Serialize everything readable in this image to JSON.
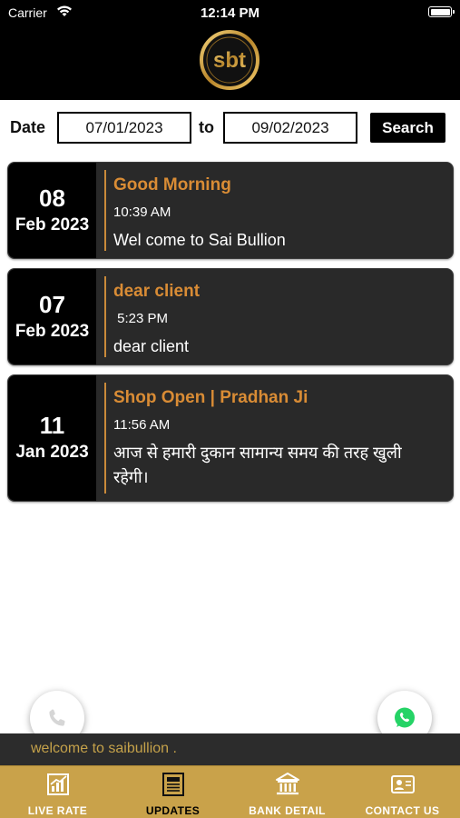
{
  "status_bar": {
    "carrier": "Carrier",
    "time": "12:14 PM"
  },
  "header": {
    "logo_text": "sbt"
  },
  "filter": {
    "date_label": "Date",
    "from_value": "07/01/2023",
    "to_label": "to",
    "to_value": "09/02/2023",
    "search_label": "Search"
  },
  "updates": [
    {
      "day": "08",
      "month": "Feb 2023",
      "title": "Good Morning",
      "time": "10:39 AM",
      "message": "Wel come to Sai Bullion"
    },
    {
      "day": "07",
      "month": "Feb 2023",
      "title": "dear client",
      "time": " 5:23 PM",
      "message": "dear client"
    },
    {
      "day": "11",
      "month": "Jan 2023",
      "title": "Shop Open | Pradhan Ji",
      "time": "11:56 AM",
      "message": "आज से हमारी दुकान सामान्य समय की तरह खुली रहेगी।"
    }
  ],
  "ticker": {
    "text": "welcome to saibullion ."
  },
  "tabs": [
    {
      "label": "LIVE RATE",
      "icon": "chart-icon",
      "active": false
    },
    {
      "label": "UPDATES",
      "icon": "newspaper-icon",
      "active": true
    },
    {
      "label": "BANK DETAIL",
      "icon": "bank-icon",
      "active": false
    },
    {
      "label": "CONTACT US",
      "icon": "contact-card-icon",
      "active": false
    }
  ],
  "colors": {
    "accent_gold": "#c9a24a",
    "title_orange": "#d98c35",
    "card_bg": "#292929",
    "whatsapp_green": "#25d366"
  }
}
